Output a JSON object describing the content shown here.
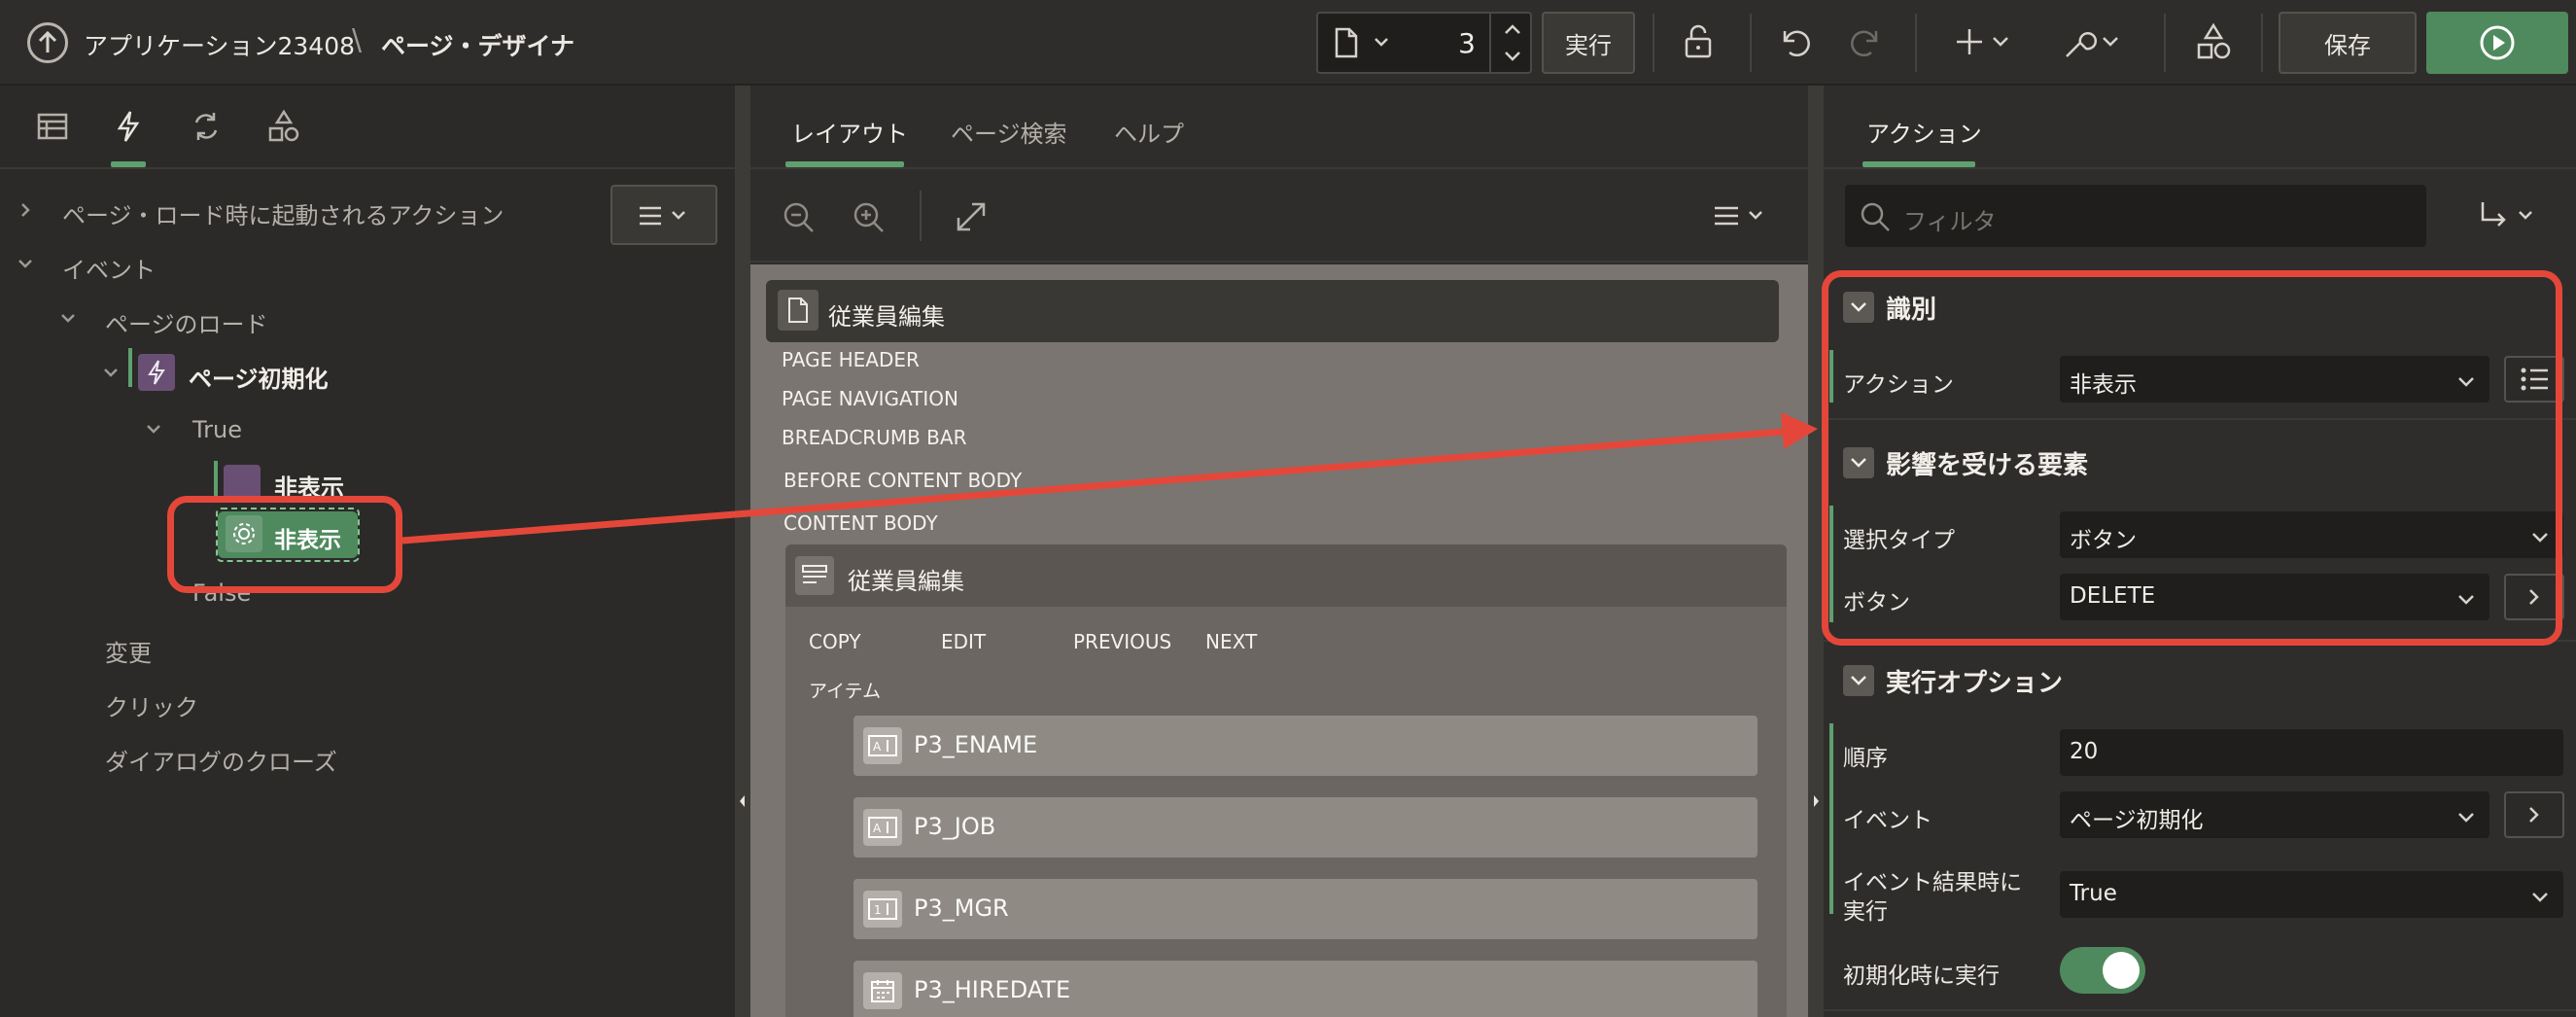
{
  "header": {
    "app_title": "アプリケーション23408",
    "separator": "\\",
    "subtitle": "ページ・デザイナ",
    "page_number": "3",
    "run_label": "実行",
    "save_label": "保存"
  },
  "left_panel": {
    "tree": {
      "page_load_actions": "ページ・ロード時に起動されるアクション",
      "events": "イベント",
      "page_load": "ページのロード",
      "page_init": "ページ初期化",
      "true_label": "True",
      "hide_action_1": "非表示",
      "hide_action_2": "非表示",
      "false_label": "False",
      "change": "変更",
      "click": "クリック",
      "dialog_close": "ダイアログのクローズ"
    }
  },
  "center_panel": {
    "tabs": [
      "レイアウト",
      "ページ検索",
      "ヘルプ"
    ],
    "page_region_title": "従業員編集",
    "positions": [
      "PAGE HEADER",
      "PAGE NAVIGATION",
      "BREADCRUMB BAR",
      "BEFORE CONTENT BODY",
      "CONTENT BODY"
    ],
    "form_region_title": "従業員編集",
    "buttons": [
      "COPY",
      "EDIT",
      "PREVIOUS",
      "NEXT"
    ],
    "items_label": "アイテム",
    "items": [
      "P3_ENAME",
      "P3_JOB",
      "P3_MGR",
      "P3_HIREDATE"
    ]
  },
  "right_panel": {
    "tab": "アクション",
    "filter_placeholder": "フィルタ",
    "sections": {
      "identification": "識別",
      "affected": "影響を受ける要素",
      "execution": "実行オプション"
    },
    "action_label": "アクション",
    "action_value": "非表示",
    "selection_type_label": "選択タイプ",
    "selection_type_value": "ボタン",
    "button_label": "ボタン",
    "button_value": "DELETE",
    "sequence_label": "順序",
    "sequence_value": "20",
    "event_label": "イベント",
    "event_value": "ページ初期化",
    "fire_on_result_label_1": "イベント結果時に",
    "fire_on_result_label_2": "実行",
    "fire_on_result_value": "True",
    "fire_on_init_label": "初期化時に実行",
    "fire_on_init_state": "on"
  },
  "colors": {
    "accent": "#5fa06f",
    "highlight": "#e4473a",
    "run_button": "#4e8a5d"
  }
}
